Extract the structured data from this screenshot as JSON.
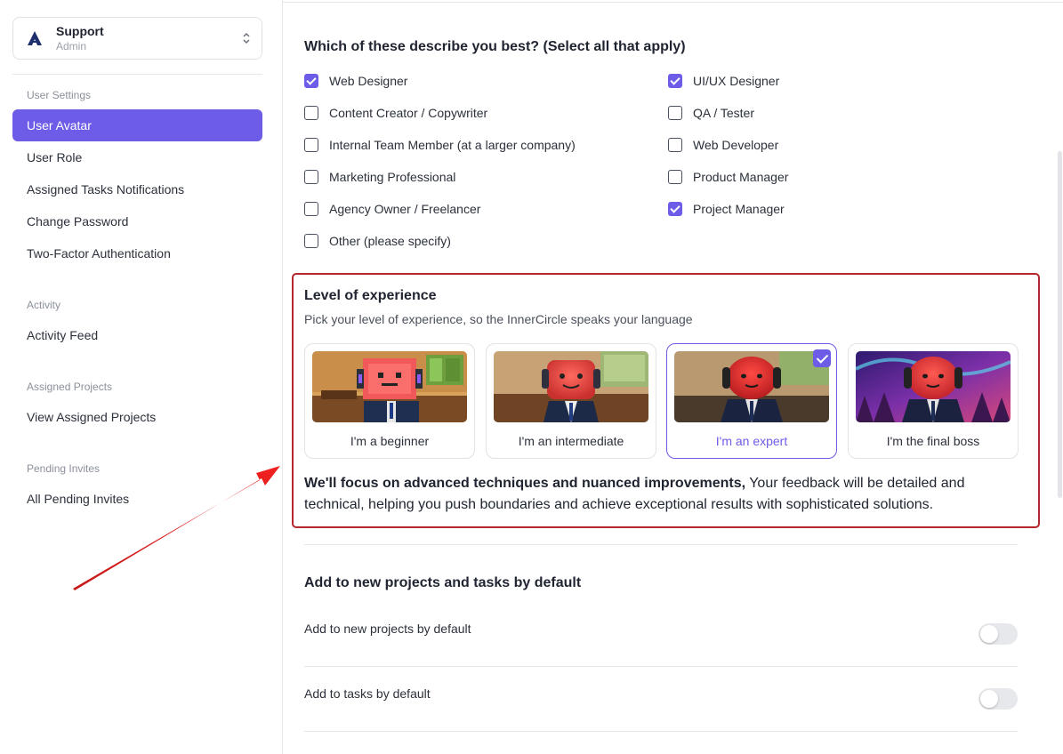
{
  "workspace": {
    "name": "Support",
    "role": "Admin"
  },
  "sidebar": {
    "sections": [
      {
        "title": "User Settings",
        "items": [
          "User Avatar",
          "User Role",
          "Assigned Tasks Notifications",
          "Change Password",
          "Two-Factor Authentication"
        ]
      },
      {
        "title": "Activity",
        "items": [
          "Activity Feed"
        ]
      },
      {
        "title": "Assigned Projects",
        "items": [
          "View Assigned Projects"
        ]
      },
      {
        "title": "Pending Invites",
        "items": [
          "All Pending Invites"
        ]
      }
    ],
    "active_item": "User Avatar"
  },
  "describe": {
    "title": "Which of these describe you best? (Select all that apply)",
    "left_options": [
      {
        "label": "Web Designer",
        "checked": true
      },
      {
        "label": "Content Creator / Copywriter",
        "checked": false
      },
      {
        "label": "Internal Team Member (at a larger company)",
        "checked": false
      },
      {
        "label": "Marketing Professional",
        "checked": false
      },
      {
        "label": "Agency Owner / Freelancer",
        "checked": false
      },
      {
        "label": "Other (please specify)",
        "checked": false
      }
    ],
    "right_options": [
      {
        "label": "UI/UX Designer",
        "checked": true
      },
      {
        "label": "QA / Tester",
        "checked": false
      },
      {
        "label": "Web Developer",
        "checked": false
      },
      {
        "label": "Product Manager",
        "checked": false
      },
      {
        "label": "Project Manager",
        "checked": true
      }
    ]
  },
  "experience": {
    "title": "Level of experience",
    "subtitle": "Pick your level of experience, so the InnerCircle speaks your language",
    "levels": [
      {
        "label": "I'm a beginner",
        "selected": false
      },
      {
        "label": "I'm an intermediate",
        "selected": false
      },
      {
        "label": "I'm an expert",
        "selected": true
      },
      {
        "label": "I'm the final boss",
        "selected": false
      }
    ],
    "description_bold": "We'll focus on advanced techniques and nuanced improvements,",
    "description_rest": " Your feedback will be detailed and technical, helping you push boundaries and achieve exceptional results with sophisticated solutions."
  },
  "defaults": {
    "title": "Add to new projects and tasks by default",
    "toggles": [
      {
        "label": "Add to new projects by default",
        "on": false
      },
      {
        "label": "Add to tasks by default",
        "on": false
      }
    ]
  },
  "colors": {
    "accent": "#6d5ce8",
    "highlight_border": "#b3272d",
    "arrow": "#e01b1b"
  }
}
